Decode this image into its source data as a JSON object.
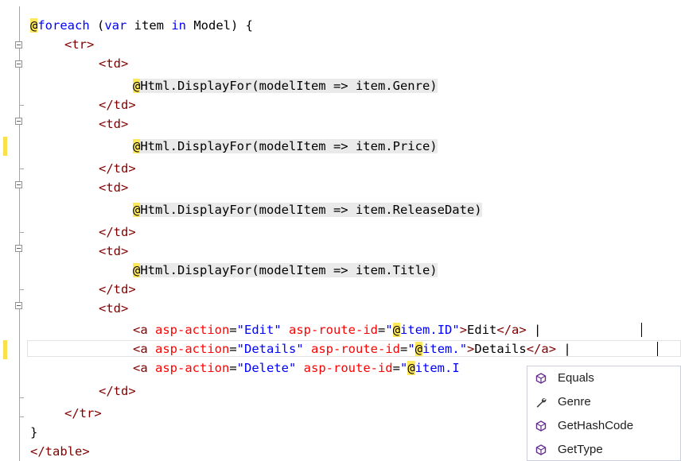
{
  "editor": {
    "lines": {
      "l0": {
        "at": "@",
        "kw1": "foreach",
        "paren_open": " (",
        "kw2": "var",
        "mid1": " item ",
        "kw3": "in",
        "rest": " Model) {"
      },
      "l1": {
        "tag": "<tr>"
      },
      "l2": {
        "tag": "<td>"
      },
      "l3": {
        "at": "@",
        "code": "Html.DisplayFor(modelItem => item.Genre)"
      },
      "l4": {
        "tag": "</td>"
      },
      "l5": {
        "tag": "<td>"
      },
      "l6": {
        "at": "@",
        "code": "Html.DisplayFor(modelItem => item.Price)"
      },
      "l7": {
        "tag": "</td>"
      },
      "l8": {
        "tag": "<td>"
      },
      "l9": {
        "at": "@",
        "code": "Html.DisplayFor(modelItem => item.ReleaseDate)"
      },
      "l10": {
        "tag": "</td>"
      },
      "l11": {
        "tag": "<td>"
      },
      "l12": {
        "at": "@",
        "code": "Html.DisplayFor(modelItem => item.Title)"
      },
      "l13": {
        "tag": "</td>"
      },
      "l14": {
        "tag": "<td>"
      },
      "l15": {
        "open": "<a",
        "attr1": " asp-action",
        "eq1": "=",
        "val1": "\"Edit\"",
        "attr2": " asp-route-id",
        "eq2": "=",
        "q_open": "\"",
        "at": "@",
        "val2": "item.ID\"",
        "close": ">",
        "text": "Edit",
        "end_tag": "</a>",
        "tail": " |"
      },
      "l16": {
        "open": "<a",
        "attr1": " asp-action",
        "eq1": "=",
        "val1": "\"Details\"",
        "attr2": " asp-route-id",
        "eq2": "=",
        "q_open": "\"",
        "at": "@",
        "val2": "item.\"",
        "close": ">",
        "text": "Details",
        "end_tag": "</a>",
        "tail": " |"
      },
      "l17": {
        "open": "<a",
        "attr1": " asp-action",
        "eq1": "=",
        "val1": "\"Delete\"",
        "attr2": " asp-route-id",
        "eq2": "=",
        "q_open": "\"",
        "at": "@",
        "val2": "item.I"
      },
      "l18": {
        "tag": "</td>"
      },
      "l19": {
        "tag": "</tr>"
      },
      "l20": {
        "text": "}"
      },
      "l21": {
        "tag": "</table>"
      }
    }
  },
  "completion": {
    "items": [
      {
        "label": "Equals",
        "icon": "method-icon"
      },
      {
        "label": "Genre",
        "icon": "property-icon"
      },
      {
        "label": "GetHashCode",
        "icon": "method-icon"
      },
      {
        "label": "GetType",
        "icon": "method-icon"
      }
    ],
    "colors": {
      "method": "#652d90",
      "property": "#424242"
    }
  },
  "colors": {
    "keyword": "#0000ff",
    "tag": "#800000",
    "attribute": "#ff0000",
    "razor_highlight": "#fce85a",
    "change_mark": "#f8e14a"
  }
}
